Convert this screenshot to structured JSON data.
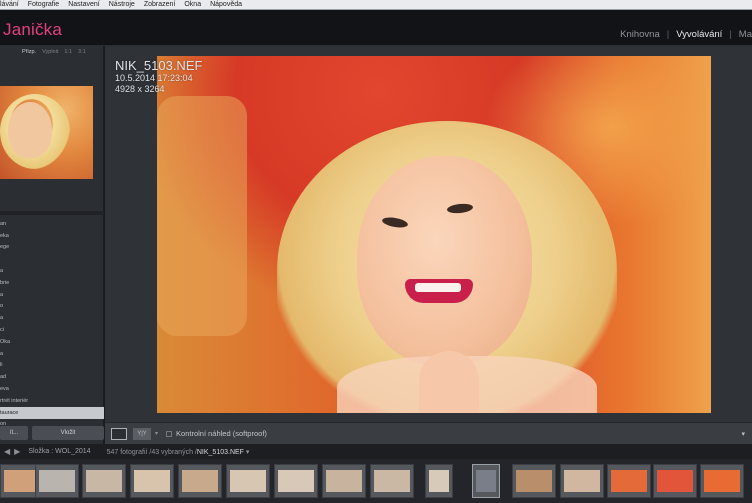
{
  "menubar": [
    "lávání",
    "Fotografie",
    "Nastavení",
    "Nástroje",
    "Zobrazení",
    "Okna",
    "Nápověda"
  ],
  "identity": "Janička",
  "modules": {
    "library": "Knihovna",
    "develop": "Vyvolávání",
    "next": "Ma"
  },
  "left_panel": {
    "navigator_tabs": [
      "Přizp.",
      "Vyplnit",
      "1:1",
      "3:1"
    ],
    "presets": [
      "an",
      "eka",
      "ege",
      "",
      "a",
      "brie",
      "a",
      "o",
      "a",
      "ci",
      "Oka",
      "a",
      "li",
      "ad",
      "eva",
      "rtrét interiér",
      "taurace",
      "on",
      "pinky"
    ],
    "selected_index": 16,
    "buttons": {
      "left": "ít...",
      "right": "Vložit"
    }
  },
  "photo": {
    "filename": "NIK_5103.NEF",
    "datetime": "10.5.2014 17:23:04",
    "dimensions": "4928 x 3264"
  },
  "toolbar": {
    "softproof_label": "Kontrolní náhled (softproof)",
    "menu_arrow": "▾"
  },
  "filmstrip_bar": {
    "source": "Složka : WOL_2014",
    "count": "547 fotografií /43 vybraných /",
    "current": "NIK_5103.NEF"
  },
  "colors": {
    "identity_pink": "#e4407f",
    "panel_bg": "#2b2e33",
    "viewer_bg": "#2f3237"
  },
  "filmstrip_thumbs": [
    {
      "tone": "#cfa07a"
    },
    {
      "tone": "#b9b4ad"
    },
    {
      "tone": "#c9b7a6"
    },
    {
      "tone": "#d8c3ad"
    },
    {
      "tone": "#c9a98c"
    },
    {
      "tone": "#d7c6b2"
    },
    {
      "tone": "#d8c8b7"
    },
    {
      "tone": "#c7b39e"
    },
    {
      "tone": "#cbb8a4"
    },
    {
      "tone": "#d7cab8"
    },
    {
      "tone": "#7a7e88"
    },
    {
      "tone": "#b98f6b"
    },
    {
      "tone": "#d1b79f"
    },
    {
      "tone": "#e46a3a"
    },
    {
      "tone": "#e3553a"
    },
    {
      "tone": "#e86b34"
    },
    {
      "tone": "#df6a44"
    },
    {
      "tone": "#e0603f"
    }
  ]
}
